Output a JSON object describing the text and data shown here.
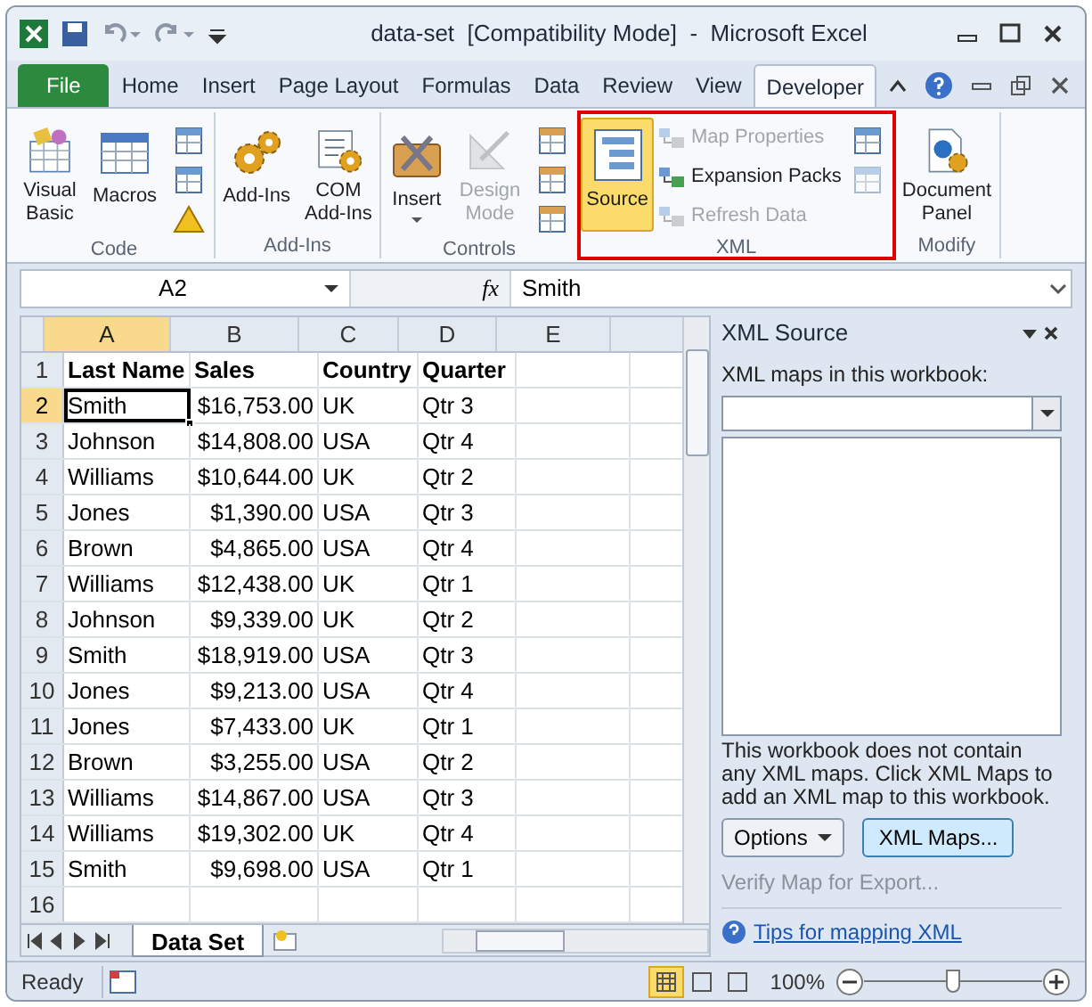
{
  "window": {
    "title": "data-set  [Compatibility Mode]  -  Microsoft Excel"
  },
  "tabs": [
    {
      "label": "File",
      "kind": "file",
      "selected": false
    },
    {
      "label": "Home",
      "kind": "tab",
      "selected": false
    },
    {
      "label": "Insert",
      "kind": "tab",
      "selected": false
    },
    {
      "label": "Page Layout",
      "kind": "tab",
      "selected": false
    },
    {
      "label": "Formulas",
      "kind": "tab",
      "selected": false
    },
    {
      "label": "Data",
      "kind": "tab",
      "selected": false
    },
    {
      "label": "Review",
      "kind": "tab",
      "selected": false
    },
    {
      "label": "View",
      "kind": "tab",
      "selected": false
    },
    {
      "label": "Developer",
      "kind": "tab",
      "selected": true
    }
  ],
  "ribbon_groups": [
    {
      "label": "Code",
      "highlighted": false,
      "buttons": [
        {
          "kind": "large",
          "label": "Visual Basic",
          "disabled": false,
          "selected": false
        },
        {
          "kind": "large",
          "label": "Macros",
          "disabled": false,
          "selected": false
        },
        {
          "kind": "icons",
          "items": [
            {
              "disabled": false
            },
            {
              "disabled": false
            },
            {
              "disabled": false
            }
          ]
        }
      ]
    },
    {
      "label": "Add-Ins",
      "highlighted": false,
      "buttons": [
        {
          "kind": "large",
          "label": "Add-Ins",
          "disabled": false,
          "selected": false
        },
        {
          "kind": "large",
          "label": "COM Add-Ins",
          "disabled": false,
          "selected": false
        }
      ]
    },
    {
      "label": "Controls",
      "highlighted": false,
      "buttons": [
        {
          "kind": "large",
          "label": "Insert",
          "disabled": false,
          "selected": false,
          "dropdown": true
        },
        {
          "kind": "large",
          "label": "Design Mode",
          "disabled": true,
          "selected": false
        },
        {
          "kind": "icons",
          "items": [
            {
              "disabled": false
            },
            {
              "disabled": false
            },
            {
              "disabled": false
            }
          ]
        }
      ]
    },
    {
      "label": "XML",
      "highlighted": true,
      "buttons": [
        {
          "kind": "large",
          "label": "Source",
          "disabled": false,
          "selected": true
        },
        {
          "kind": "small_list",
          "items": [
            {
              "label": "Map Properties",
              "disabled": true
            },
            {
              "label": "Expansion Packs",
              "disabled": false
            },
            {
              "label": "Refresh Data",
              "disabled": true
            }
          ]
        },
        {
          "kind": "icons",
          "items": [
            {
              "disabled": false
            },
            {
              "disabled": true
            }
          ]
        }
      ]
    },
    {
      "label": "Modify",
      "highlighted": false,
      "buttons": [
        {
          "kind": "large",
          "label": "Document Panel",
          "disabled": false,
          "selected": false
        }
      ]
    }
  ],
  "formula_bar": {
    "name_box": "A2",
    "fx": "fx",
    "value": "Smith"
  },
  "sheet": {
    "columns": [
      {
        "label": "A",
        "kind": "text",
        "selected": true
      },
      {
        "label": "B",
        "kind": "currency",
        "selected": false
      },
      {
        "label": "C",
        "kind": "text",
        "selected": false
      },
      {
        "label": "D",
        "kind": "text",
        "selected": false
      },
      {
        "label": "E",
        "kind": "text",
        "selected": false
      }
    ],
    "rows": [
      {
        "number": "1",
        "kind": "header",
        "selected": false,
        "cells": [
          "Last Name",
          "Sales",
          "Country",
          "Quarter"
        ]
      },
      {
        "number": "2",
        "kind": "data",
        "selected": true,
        "cells": [
          "Smith",
          "$16,753.00",
          "UK",
          "Qtr 3"
        ]
      },
      {
        "number": "3",
        "kind": "data",
        "selected": false,
        "cells": [
          "Johnson",
          "$14,808.00",
          "USA",
          "Qtr 4"
        ]
      },
      {
        "number": "4",
        "kind": "data",
        "selected": false,
        "cells": [
          "Williams",
          "$10,644.00",
          "UK",
          "Qtr 2"
        ]
      },
      {
        "number": "5",
        "kind": "data",
        "selected": false,
        "cells": [
          "Jones",
          "$1,390.00",
          "USA",
          "Qtr 3"
        ]
      },
      {
        "number": "6",
        "kind": "data",
        "selected": false,
        "cells": [
          "Brown",
          "$4,865.00",
          "USA",
          "Qtr 4"
        ]
      },
      {
        "number": "7",
        "kind": "data",
        "selected": false,
        "cells": [
          "Williams",
          "$12,438.00",
          "UK",
          "Qtr 1"
        ]
      },
      {
        "number": "8",
        "kind": "data",
        "selected": false,
        "cells": [
          "Johnson",
          "$9,339.00",
          "UK",
          "Qtr 2"
        ]
      },
      {
        "number": "9",
        "kind": "data",
        "selected": false,
        "cells": [
          "Smith",
          "$18,919.00",
          "USA",
          "Qtr 3"
        ]
      },
      {
        "number": "10",
        "kind": "data",
        "selected": false,
        "cells": [
          "Jones",
          "$9,213.00",
          "USA",
          "Qtr 4"
        ]
      },
      {
        "number": "11",
        "kind": "data",
        "selected": false,
        "cells": [
          "Jones",
          "$7,433.00",
          "UK",
          "Qtr 1"
        ]
      },
      {
        "number": "12",
        "kind": "data",
        "selected": false,
        "cells": [
          "Brown",
          "$3,255.00",
          "USA",
          "Qtr 2"
        ]
      },
      {
        "number": "13",
        "kind": "data",
        "selected": false,
        "cells": [
          "Williams",
          "$14,867.00",
          "USA",
          "Qtr 3"
        ]
      },
      {
        "number": "14",
        "kind": "data",
        "selected": false,
        "cells": [
          "Williams",
          "$19,302.00",
          "UK",
          "Qtr 4"
        ]
      },
      {
        "number": "15",
        "kind": "data",
        "selected": false,
        "cells": [
          "Smith",
          "$9,698.00",
          "USA",
          "Qtr 1"
        ]
      },
      {
        "number": "16",
        "kind": "data",
        "selected": false,
        "cells": []
      }
    ]
  },
  "sheet_tabs": [
    {
      "label": "Data Set",
      "selected": true
    }
  ],
  "xml_pane": {
    "title": "XML Source",
    "maps_label": "XML maps in this workbook:",
    "message": "This workbook does not contain any XML maps. Click XML Maps to add an XML map to this workbook.",
    "options_button": "Options",
    "maps_button": "XML Maps...",
    "maps_button_hovered": true,
    "verify_link": "Verify Map for Export...",
    "tips_link": "Tips for mapping XML"
  },
  "status_bar": {
    "mode": "Ready",
    "views": [
      {
        "selected": true
      },
      {
        "selected": false
      },
      {
        "selected": false
      }
    ],
    "zoom": "100%",
    "zoom_slider": {
      "level": 0.5
    }
  }
}
